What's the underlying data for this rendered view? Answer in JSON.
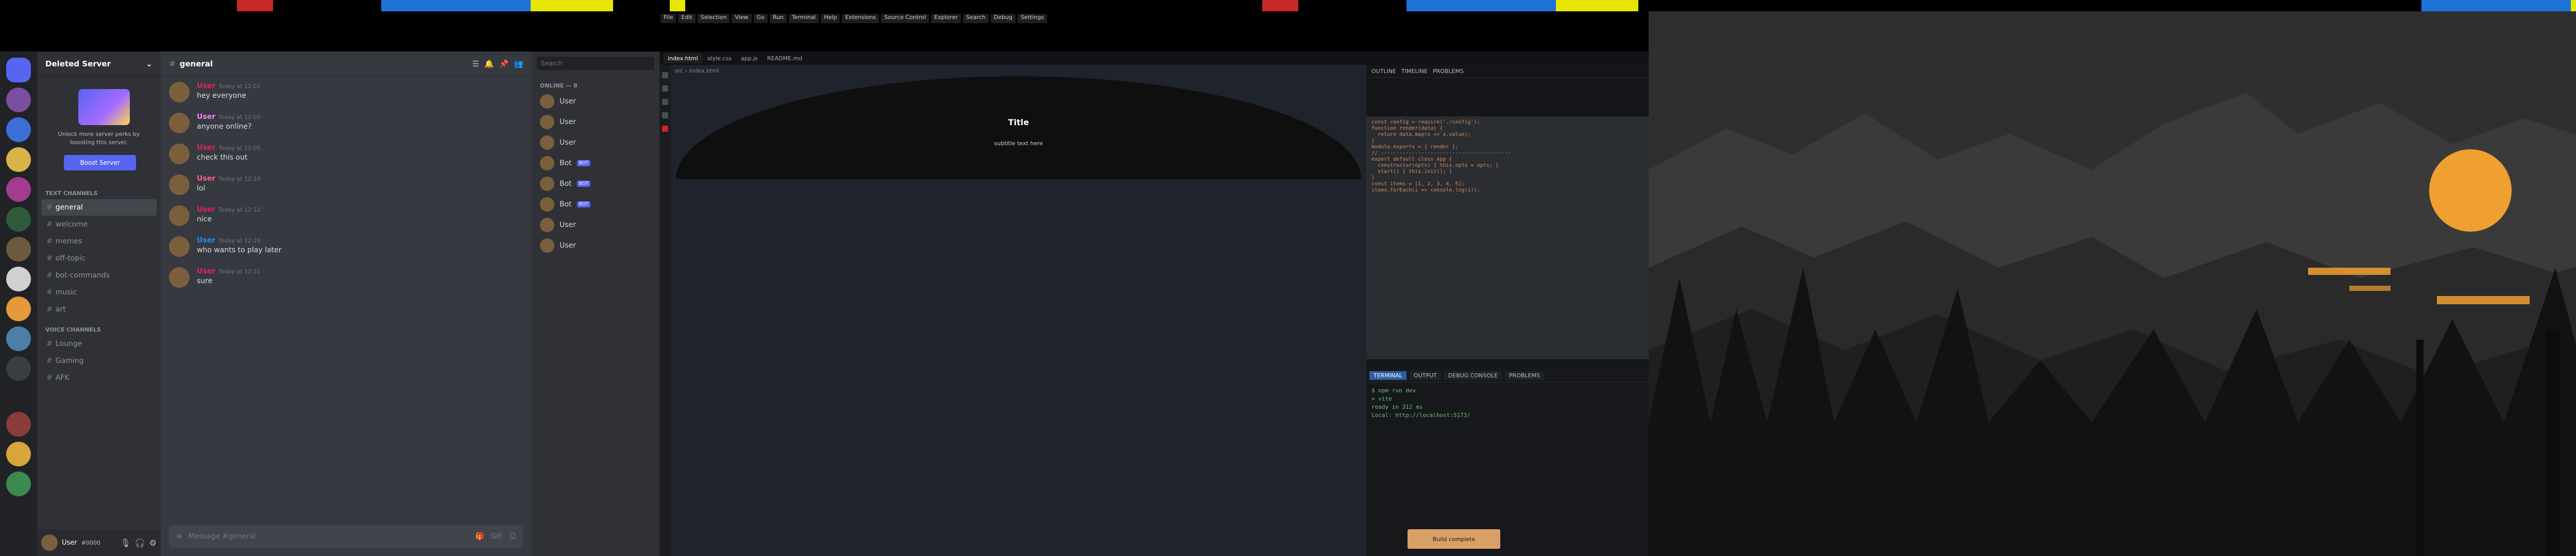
{
  "discord": {
    "server_name": "Deleted Server",
    "boost": {
      "text": "Unlock more server perks by boosting this server.",
      "button_label": "Boost Server"
    },
    "channel_categories": [
      {
        "label": "Text Channels",
        "channels": [
          "general",
          "welcome",
          "memes",
          "off-topic",
          "bot-commands",
          "music",
          "art"
        ]
      },
      {
        "label": "Voice Channels",
        "channels": [
          "Lounge",
          "Gaming",
          "AFK"
        ]
      }
    ],
    "active_channel": "general",
    "chat_header": "general",
    "messages": [
      {
        "user": "User",
        "time": "Today at 12:01",
        "text": "hey everyone"
      },
      {
        "user": "User",
        "time": "Today at 12:03",
        "text": "anyone online?"
      },
      {
        "user": "User",
        "time": "Today at 12:05",
        "text": "check this out"
      },
      {
        "user": "User",
        "time": "Today at 12:10",
        "text": "lol"
      },
      {
        "user": "User",
        "time": "Today at 12:12",
        "text": "nice"
      },
      {
        "user": "User",
        "time": "Today at 12:20",
        "text": "who wants to play later"
      },
      {
        "user": "User",
        "time": "Today at 12:31",
        "text": "sure"
      }
    ],
    "composer_placeholder": "Message #general",
    "members_search": "Search",
    "member_groups": [
      {
        "label": "ONLINE — 8",
        "members": [
          "User",
          "User",
          "User",
          "Bot",
          "Bot",
          "Bot",
          "User",
          "User"
        ]
      }
    ],
    "user_panel": {
      "name": "User",
      "tag": "#0000"
    }
  },
  "vscode": {
    "menu": [
      "File",
      "Edit",
      "Selection",
      "View",
      "Go",
      "Run",
      "Terminal",
      "Help",
      "Extensions",
      "Source Control",
      "Explorer",
      "Search",
      "Debug",
      "Settings"
    ],
    "tabs": [
      "index.html",
      "style.css",
      "app.js",
      "README.md"
    ],
    "active_tab": "index.html",
    "breadcrumb": "src › index.html",
    "preview_title": "Title",
    "preview_subtitle": "subtitle text here",
    "side_panel_tabs": [
      "OUTLINE",
      "TIMELINE",
      "PROBLEMS"
    ],
    "code_lines": [
      "const config = require('./config');",
      "function render(data) {",
      "  return data.map(x => x.value);",
      "}",
      "module.exports = { render };",
      "// ------------------------------------------",
      "export default class App {",
      "  constructor(opts) { this.opts = opts; }",
      "  start() { this.init(); }",
      "}",
      "const items = [1, 2, 3, 4, 5];",
      "items.forEach(i => console.log(i));"
    ],
    "terminal_tabs": [
      "TERMINAL",
      "OUTPUT",
      "DEBUG CONSOLE",
      "PROBLEMS"
    ],
    "terminal_lines": [
      "$ npm run dev",
      "> vite",
      "ready in 312 ms",
      "Local: http://localhost:5173/"
    ],
    "toast": "Build complete"
  },
  "desktop": {
    "wallpaper": "mountain-sunset-firewatch"
  },
  "colors": {
    "discord_accent": "#5865f2",
    "vscode_accent": "#2c5f9e",
    "sun": "#f0a030"
  }
}
